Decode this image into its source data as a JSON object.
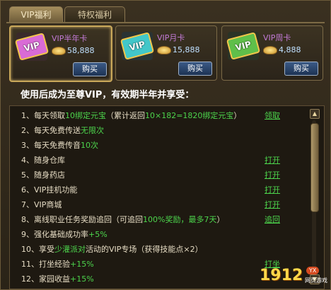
{
  "tabs": [
    {
      "label": "VIP福利"
    },
    {
      "label": "特权福利"
    }
  ],
  "cards": [
    {
      "name": "VIP半年卡",
      "price": "58,888",
      "buy": "购买",
      "icon_text": "VIP",
      "color": "#d96bd6"
    },
    {
      "name": "VIP月卡",
      "price": "15,888",
      "buy": "购买",
      "icon_text": "VIP",
      "color": "#42c7c9"
    },
    {
      "name": "VIP周卡",
      "price": "4,888",
      "buy": "购买",
      "icon_text": "VIP",
      "color": "#5fbf4a"
    }
  ],
  "headline": "使用后成为至尊VIP，有效期半年并享受：",
  "benefits": [
    {
      "parts": [
        {
          "t": "1、每天领取"
        },
        {
          "g": "10绑定元宝"
        },
        {
          "t": "（累计返回"
        },
        {
          "g": "10×182=1820绑定元宝"
        },
        {
          "t": "）"
        }
      ],
      "action": "领取"
    },
    {
      "parts": [
        {
          "t": "2、每天免费传送"
        },
        {
          "g": "无限次"
        }
      ],
      "action": ""
    },
    {
      "parts": [
        {
          "t": "3、每天免费传音"
        },
        {
          "g": "10次"
        }
      ],
      "action": ""
    },
    {
      "parts": [
        {
          "t": "4、随身仓库"
        }
      ],
      "action": "打开"
    },
    {
      "parts": [
        {
          "t": "5、随身药店"
        }
      ],
      "action": "打开"
    },
    {
      "parts": [
        {
          "t": "6、VIP挂机功能"
        }
      ],
      "action": "打开"
    },
    {
      "parts": [
        {
          "t": "7、VIP商城"
        }
      ],
      "action": "打开"
    },
    {
      "parts": [
        {
          "t": "8、离线职业任务奖励追回（可追回"
        },
        {
          "g": "100%奖励，最多7天"
        },
        {
          "t": "）"
        }
      ],
      "action": "追回"
    },
    {
      "parts": [
        {
          "t": "9、强化基础成功率"
        },
        {
          "g": "+5%"
        }
      ],
      "action": ""
    },
    {
      "parts": [
        {
          "t": "10、享受"
        },
        {
          "g": "少灌派对"
        },
        {
          "t": "活动的VIP专场（获得技能点×2）"
        }
      ],
      "action": ""
    },
    {
      "parts": [
        {
          "t": "11、打坐经验"
        },
        {
          "g": "+15%"
        }
      ],
      "action": "打坐"
    },
    {
      "parts": [
        {
          "t": "12、家园收益"
        },
        {
          "g": "+15%"
        }
      ],
      "action": ""
    }
  ],
  "logo": {
    "main": "1912",
    "badge": "YX",
    "sub": "网页游戏"
  }
}
